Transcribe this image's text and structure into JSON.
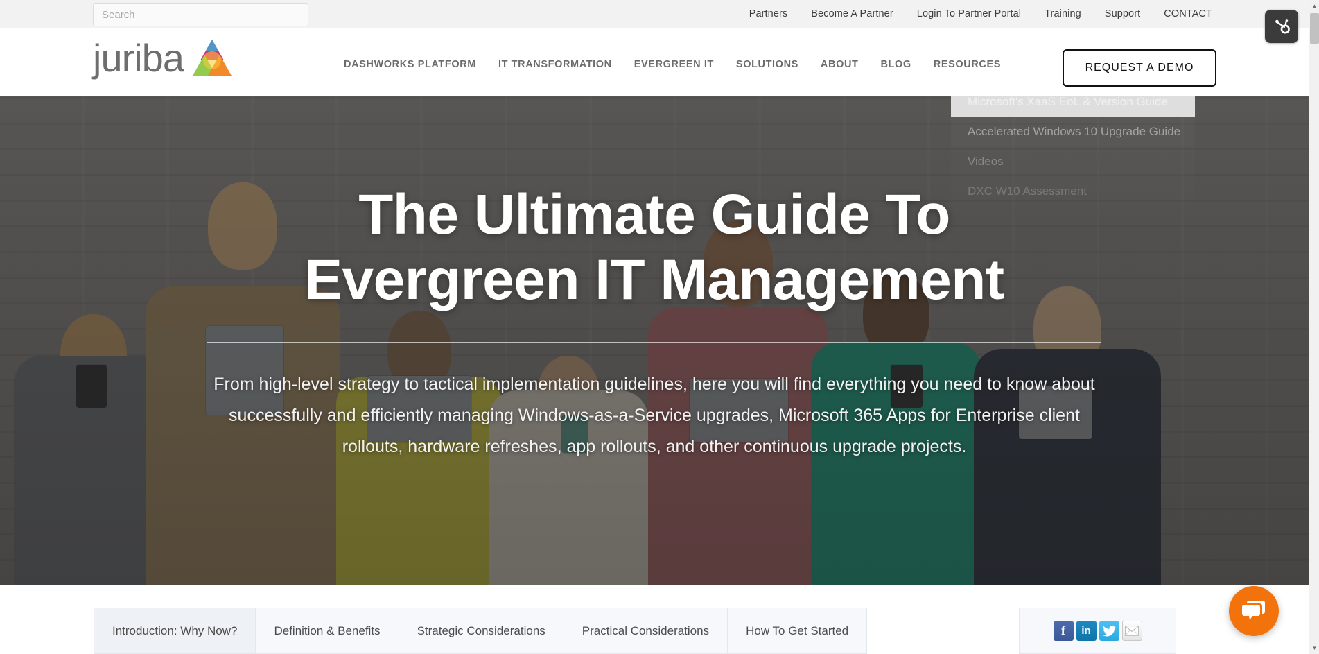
{
  "utility_bar": {
    "search": {
      "placeholder": "Search",
      "value": ""
    },
    "links": [
      {
        "label": "Partners"
      },
      {
        "label": "Become A Partner"
      },
      {
        "label": "Login To Partner Portal"
      },
      {
        "label": "Training"
      },
      {
        "label": "Support"
      },
      {
        "label": "CONTACT"
      }
    ]
  },
  "header": {
    "logo_text": "juriba",
    "logo_icon": "juriba-triangle-logo",
    "nav": [
      {
        "label": "DASHWORKS PLATFORM"
      },
      {
        "label": "IT TRANSFORMATION"
      },
      {
        "label": "EVERGREEN IT"
      },
      {
        "label": "SOLUTIONS"
      },
      {
        "label": "ABOUT"
      },
      {
        "label": "BLOG"
      },
      {
        "label": "RESOURCES"
      }
    ],
    "cta_label": "REQUEST A DEMO"
  },
  "resources_dropdown": {
    "open": true,
    "items": [
      {
        "label": "Microsoft's XaaS EoL & Version Guide"
      },
      {
        "label": "Accelerated Windows 10 Upgrade Guide"
      },
      {
        "label": "Videos"
      },
      {
        "label": "DXC W10 Assessment"
      }
    ]
  },
  "hero": {
    "title": "The Ultimate Guide To Evergreen IT Management",
    "subtitle": "From high-level strategy to tactical implementation guidelines, here you will find everything you need to know about successfully and efficiently managing Windows-as-a-Service upgrades, Microsoft 365 Apps for Enterprise client rollouts, hardware refreshes, app rollouts, and other continuous upgrade projects."
  },
  "chapter_tabs": [
    {
      "label": "Introduction: Why Now?",
      "active": true
    },
    {
      "label": "Definition & Benefits",
      "active": false
    },
    {
      "label": "Strategic Considerations",
      "active": false
    },
    {
      "label": "Practical Considerations",
      "active": false
    },
    {
      "label": "How To Get Started",
      "active": false
    }
  ],
  "share": {
    "icons": [
      {
        "name": "facebook-share-icon",
        "glyph": "f"
      },
      {
        "name": "linkedin-share-icon",
        "glyph": "in"
      },
      {
        "name": "twitter-share-icon",
        "glyph": ""
      },
      {
        "name": "email-share-icon",
        "glyph": ""
      }
    ]
  },
  "widgets": {
    "hubspot_badge": "hubspot-sprocket-icon",
    "chat_launcher": "chat-bubble-icon"
  },
  "colors": {
    "brand_grey": "#6e6e6e",
    "chat_orange": "#f2720c",
    "facebook_blue": "#3b5998",
    "linkedin_blue": "#0e76a8",
    "twitter_blue": "#2aa9e0",
    "tab_bg": "#f6f8fb",
    "utility_bg": "#f2f2f2"
  }
}
